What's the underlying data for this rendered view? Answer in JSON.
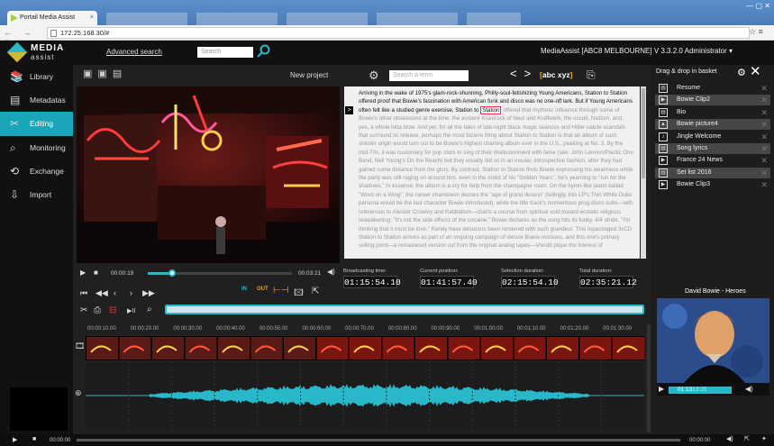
{
  "browser": {
    "tab_title": "Portail Media Assist",
    "tab_close": "×",
    "url": "172.25.168.30/#",
    "nav": "← → C",
    "window_controls": "— ▢ ✕",
    "menu_icons": "☆ ≡"
  },
  "header": {
    "logo_line1": "MEDIA",
    "logo_line2": "assist",
    "advanced_search": "Advanced search",
    "search_placeholder": "Search",
    "user_info": "MediaAssist [ABC8 MELBOURNE]    V 3.3.2.0    Administrator ▾"
  },
  "sidebar": {
    "items": [
      {
        "label": "Library",
        "icon": "books-icon"
      },
      {
        "label": "Metadatas",
        "icon": "tag-icon"
      },
      {
        "label": "Editing",
        "icon": "scissors-icon"
      },
      {
        "label": "Monitoring",
        "icon": "magnifier-icon"
      },
      {
        "label": "Exchange",
        "icon": "exchange-icon"
      },
      {
        "label": "Import",
        "icon": "import-icon"
      }
    ]
  },
  "workspace": {
    "project_title": "New project",
    "term_placeholder": "Search a term",
    "abc_label": "abc",
    "xyz_label": "xyz",
    "player_current": "00:00:19",
    "player_total": "00:03:21",
    "progress_fraction": 0.17,
    "text_paragraph_dark": "Arriving in the wake of 1975's glam-rock-shunning, Philly-soul-fetishizing Young Americans, Station to Station offered proof that Bowie's fascination with American funk and disco was no one-off lark. But if Young Americans often felt like a studied genre exercise, Station to",
    "text_highlight": "Station",
    "text_paragraph_grey": " offered that rhythmic influence through some of Bowie's other obsessions at the time: the austere Krautrock of Neu! and Kraftwerk, the occult, Nazism, and, yes, a whole lotta blow. And yet, for all the tales of late-night black magic seances and Hitler-salute scandals that surround its release, perhaps the most bizarre thing about Station to Station is that an album of such sinister origin would turn out to be Bowie's highest charting album ever in the U.S., peaking at No. 3. By the mid-70s, it was customary for pop stars to sing of their disillusionment with fame (see: John Lennon/Plastic Ono Band, Neil Young's On the Beach) but they usually did so in an insular, introspective fashion, after they had gained some distance from the glory. By contrast, Station to Station finds Bowie expressing his weariness while the party was still raging on around him, even in the midst of his \"Golden Years\", he's yearning to \"run for the shadows.\" In essence, the album is a cry for help from the champagne room. On the hymn-like piano ballad \"Word on a Wing\", the career chameleon decries the \"age of grand illusion\" (tellingly, this LP's Thin White Duke persona would be the last character Bowie introduced), while the title track's momentous prog-disco suite—with references to Aleister Crowley and Kabbalism—charts a course from spiritual void toward ecstatic religious reawakening: \"It's not the side effects of the cocaine,\" Bowie declares as the song hits its funky, 4/4 stride, \"I'm thinking that it must be love.\" Rarely have delusions been rendered with such grandeur. This repackaged 3xCD Station to Station arrives as part of an ongoing campaign of deluxe Bowie reissues, and this one's primary selling point—a remastered version cut from the original analog tapes—should pique the interest of",
    "broadcasting_label": "Broadcasting time:",
    "broadcasting_value": "01:15:54.10",
    "current_label": "Current position:",
    "current_value": "01:41:57.40",
    "selection_label": "Selection duration:",
    "selection_value": "02:15:54.10",
    "total_label": "Total duration:",
    "total_value": "02:35:21.12",
    "in_label": "IN",
    "out_label": "OUT",
    "ruler_ticks": [
      "00:00:10.00",
      "00:00:20.00",
      "00:00:30.00",
      "00:00:40.00",
      "00:00:50.00",
      "00:00:60.00",
      "00:00:70.00",
      "00:00:80.00",
      "00:00:90.00",
      "00:01:00.00",
      "00:01:10.00",
      "00:01:20.00",
      "00:01:30.00"
    ]
  },
  "basket": {
    "title": "Drag & drop in basket",
    "items": [
      {
        "label": "Resume",
        "type": "doc-icon",
        "alt": false
      },
      {
        "label": "Bowie Clip2",
        "type": "video-icon",
        "alt": true
      },
      {
        "label": "Bio",
        "type": "doc-icon",
        "alt": false
      },
      {
        "label": "Bowie picture4",
        "type": "image-icon",
        "alt": true
      },
      {
        "label": "Jingle Welcome",
        "type": "music-icon",
        "alt": false
      },
      {
        "label": "Song lyrics",
        "type": "doc-icon",
        "alt": true
      },
      {
        "label": "France 24 News",
        "type": "video-icon",
        "alt": false
      },
      {
        "label": "Set list 2016",
        "type": "doc-icon",
        "alt": true
      },
      {
        "label": "Bowie Clip3",
        "type": "video-icon",
        "alt": false
      }
    ],
    "thumb_title": "David Bowie - Heroes",
    "thumb_time": "01:13",
    "thumb_total": "13:25"
  },
  "bottombar": {
    "left_time": "00:00:00",
    "right_time": "00:00:00"
  },
  "colors": {
    "accent": "#29b8c9",
    "highlight": "#e5a72b"
  }
}
